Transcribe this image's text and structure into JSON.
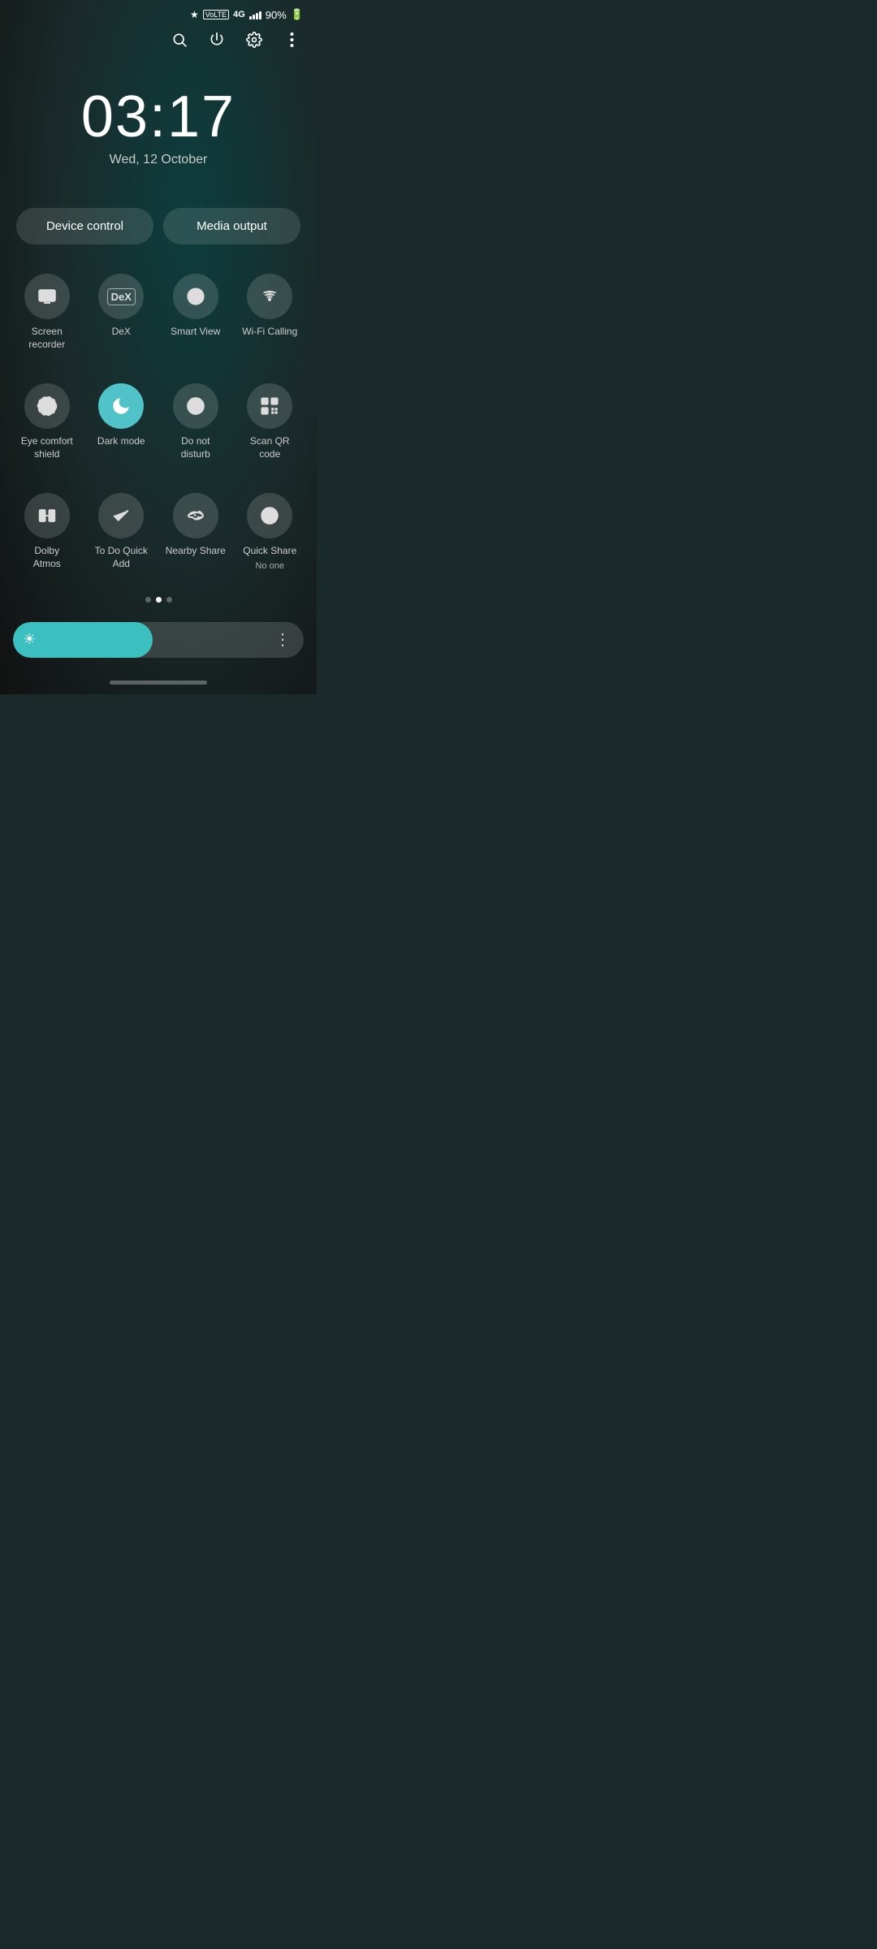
{
  "statusBar": {
    "bluetooth": "BT",
    "volte": "VoLTE",
    "network": "4G",
    "signal": 4,
    "battery": "90%"
  },
  "toolbar": {
    "search_label": "Search",
    "power_label": "Power",
    "settings_label": "Settings",
    "more_label": "More options"
  },
  "clock": {
    "time": "03:17",
    "date": "Wed, 12 October"
  },
  "controls": {
    "device_control": "Device control",
    "media_output": "Media output"
  },
  "quickSettings": {
    "row1": [
      {
        "id": "screen-recorder",
        "label": "Screen\nrecorder",
        "active": false,
        "icon": "⬜"
      },
      {
        "id": "dex",
        "label": "DeX",
        "active": false,
        "icon": "DeX"
      },
      {
        "id": "smart-view",
        "label": "Smart View",
        "active": false,
        "icon": "▷"
      },
      {
        "id": "wifi-calling",
        "label": "Wi-Fi Calling",
        "active": false,
        "icon": "📞"
      }
    ],
    "row2": [
      {
        "id": "eye-comfort",
        "label": "Eye comfort\nshield",
        "active": false,
        "icon": "A"
      },
      {
        "id": "dark-mode",
        "label": "Dark mode",
        "active": true,
        "icon": "🌙"
      },
      {
        "id": "do-not-disturb",
        "label": "Do not\ndisturb",
        "active": false,
        "icon": "—"
      },
      {
        "id": "scan-qr",
        "label": "Scan QR\ncode",
        "active": false,
        "icon": "▪"
      }
    ],
    "row3": [
      {
        "id": "dolby-atmos",
        "label": "Dolby\nAtmos",
        "active": false,
        "icon": "▐▌"
      },
      {
        "id": "todo-quick-add",
        "label": "To Do Quick\nAdd",
        "active": false,
        "icon": "✔"
      },
      {
        "id": "nearby-share",
        "label": "Nearby Share",
        "active": false,
        "icon": "~"
      },
      {
        "id": "quick-share",
        "label": "Quick Share",
        "sublabel": "No one",
        "active": false,
        "icon": "→"
      }
    ]
  },
  "pageDots": {
    "total": 3,
    "active": 1
  },
  "brightness": {
    "level": 48,
    "icon": "☀"
  }
}
